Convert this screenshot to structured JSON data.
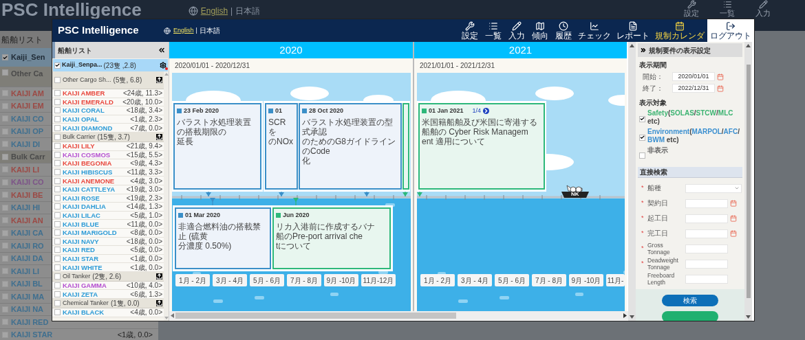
{
  "background": {
    "title": "PSC Intelligence",
    "language": {
      "english": "English",
      "separator": "|",
      "japanese": "日本語"
    },
    "nav": [
      "設定",
      "一覧",
      "入力"
    ],
    "sidebar_title": "船舶リスト",
    "fleet": {
      "name": "Kaiji_Sen",
      "checked": true
    },
    "rows": [
      {
        "kind": "category",
        "label": "Other Ca",
        "color": "#4a4a4a",
        "checked": false
      },
      {
        "kind": "ship",
        "label": "KAIJI AM",
        "color": "#9c4a45",
        "checked": false
      },
      {
        "kind": "ship",
        "label": "KAIJI EM",
        "color": "#9c4a45",
        "checked": false
      },
      {
        "kind": "ship",
        "label": "KAIJI CO",
        "color": "#3f6f8f",
        "checked": false
      },
      {
        "kind": "ship",
        "label": "KAIJI OP",
        "color": "#3f6f8f",
        "checked": false
      },
      {
        "kind": "ship",
        "label": "KAIJI DI",
        "color": "#3f6f8f",
        "checked": false
      },
      {
        "kind": "category",
        "label": "Bulk Carr",
        "color": "#4a4a4a",
        "checked": false
      },
      {
        "kind": "ship",
        "label": "KAIJI LI",
        "color": "#9c4a45",
        "checked": false
      },
      {
        "kind": "ship",
        "label": "KAIJI CO",
        "color": "#7d5488",
        "checked": false
      },
      {
        "kind": "ship",
        "label": "KAIJI BE",
        "color": "#9c4a45",
        "checked": false
      },
      {
        "kind": "ship",
        "label": "KAIJI HI",
        "color": "#3f6f8f",
        "checked": false
      },
      {
        "kind": "ship",
        "label": "KAIJI AN",
        "color": "#9c4a45",
        "checked": false
      },
      {
        "kind": "ship",
        "label": "KAIJI CA",
        "color": "#3f6f8f",
        "checked": false
      },
      {
        "kind": "ship",
        "label": "KAIJI RO",
        "color": "#3f6f8f",
        "checked": false
      },
      {
        "kind": "ship",
        "label": "KAIJI DA",
        "color": "#3f6f8f",
        "checked": false
      },
      {
        "kind": "ship",
        "label": "KAIJI LI",
        "color": "#3f6f8f",
        "checked": false
      },
      {
        "kind": "ship",
        "label": "KAIJI BL",
        "color": "#3f6f8f",
        "checked": false
      },
      {
        "kind": "ship",
        "label": "KAIJI MA",
        "color": "#3f6f8f",
        "checked": false
      },
      {
        "kind": "ship",
        "label": "KAIJI NA",
        "color": "#3f6f8f",
        "checked": false
      },
      {
        "kind": "ship",
        "label": "KAIJI RED",
        "color": "#3f6f8f",
        "checked": false
      },
      {
        "kind": "ship",
        "label": "KAIJI STAR",
        "info": "<1歳, 0.0>",
        "color": "#3f6f8f",
        "checked": false
      }
    ]
  },
  "app": {
    "title": "PSC Intelligence",
    "language": [
      {
        "label": "English",
        "selected": true
      },
      {
        "label": "日本語",
        "selected": false
      }
    ],
    "language_separator": "|",
    "nav": [
      {
        "label": "設定",
        "kind": "menu",
        "selected": false
      },
      {
        "label": "一覧",
        "kind": "menu",
        "selected": false
      },
      {
        "label": "入力",
        "kind": "menu",
        "selected": false
      },
      {
        "label": "傾向",
        "kind": "menu",
        "selected": false
      },
      {
        "label": "履歴",
        "kind": "menu",
        "selected": false
      },
      {
        "label": "チェック",
        "kind": "menu",
        "selected": false
      },
      {
        "label": "レポート",
        "kind": "menu",
        "selected": false
      },
      {
        "label": "規制カレンダ",
        "kind": "menu",
        "selected": true
      },
      {
        "label": "ログアウト",
        "kind": "logout",
        "selected": false
      }
    ]
  },
  "sidebar": {
    "title": "船舶リスト",
    "fleet": {
      "name": "Kaiji_Senpa...",
      "count": "(23隻 ,2.8)",
      "checked": true,
      "selected": true,
      "children": [
        {
          "name": "Other Cargo Sh...",
          "count": "(5隻, 6.8)",
          "checked": false,
          "children": [
            {
              "name": "KAIJI AMBER",
              "info": "<24歳, 11.3>",
              "color": "#e8463c",
              "checked": false
            },
            {
              "name": "KAIJI EMERALD",
              "info": "<20歳, 10.0>",
              "color": "#e8463c",
              "checked": false
            },
            {
              "name": "KAIJI CORAL",
              "info": "<18歳, 3.4>",
              "color": "#2a9ad6",
              "checked": false
            },
            {
              "name": "KAIJI OPAL",
              "info": "<1歳, 2.3>",
              "color": "#2a9ad6",
              "checked": false
            },
            {
              "name": "KAIJI DIAMOND",
              "info": "<7歳, 0.0>",
              "color": "#2a9ad6",
              "checked": false
            }
          ]
        },
        {
          "name": "Bulk Carrier",
          "count": "(15隻, 3.7)",
          "checked": false,
          "children": [
            {
              "name": "KAIJI LILY",
              "info": "<21歳, 9.4>",
              "color": "#e8463c",
              "checked": false
            },
            {
              "name": "KAIJI COSMOS",
              "info": "<15歳, 5.5>",
              "color": "#b44fd0",
              "checked": false
            },
            {
              "name": "KAIJI BEGONIA",
              "info": "<9歳, 4.3>",
              "color": "#e8463c",
              "checked": false
            },
            {
              "name": "KAIJI HIBISCUS",
              "info": "<11歳, 3.3>",
              "color": "#2a9ad6",
              "checked": false
            },
            {
              "name": "KAIJI ANEMONE",
              "info": "<4歳, 3.0>",
              "color": "#e8463c",
              "checked": false
            },
            {
              "name": "KAIJI CATTLEYA",
              "info": "<19歳, 3.0>",
              "color": "#2a9ad6",
              "checked": false
            },
            {
              "name": "KAIJI ROSE",
              "info": "<19歳, 2.3>",
              "color": "#2a9ad6",
              "checked": false
            },
            {
              "name": "KAIJI DAHLIA",
              "info": "<14歳, 1.3>",
              "color": "#2a9ad6",
              "checked": false
            },
            {
              "name": "KAIJI LILAC",
              "info": "<5歳, 1.0>",
              "color": "#2a9ad6",
              "checked": false
            },
            {
              "name": "KAIJI BLUE",
              "info": "<11歳, 0.0>",
              "color": "#2a9ad6",
              "checked": false
            },
            {
              "name": "KAIJI MARIGOLD",
              "info": "<8歳, 0.0>",
              "color": "#2a9ad6",
              "checked": false
            },
            {
              "name": "KAIJI NAVY",
              "info": "<18歳, 0.0>",
              "color": "#2a9ad6",
              "checked": false
            },
            {
              "name": "KAIJI RED",
              "info": "<5歳, 0.0>",
              "color": "#2a9ad6",
              "checked": false
            },
            {
              "name": "KAIJI STAR",
              "info": "<1歳, 0.0>",
              "color": "#2a9ad6",
              "checked": false
            },
            {
              "name": "KAIJI WHITE",
              "info": "<1歳, 0.0>",
              "color": "#2a9ad6",
              "checked": false
            }
          ]
        },
        {
          "name": "Oil Tanker",
          "count": "(2隻, 2.6)",
          "checked": false,
          "children": [
            {
              "name": "KAIJI GAMMA",
              "info": "<10歳, 4.0>",
              "color": "#b44fd0",
              "checked": false
            },
            {
              "name": "KAIJI ZETA",
              "info": "<6歳, 1.3>",
              "color": "#2a9ad6",
              "checked": false
            }
          ]
        },
        {
          "name": "Chemical Tanker",
          "count": "(1隻, 0.0)",
          "checked": false,
          "children": [
            {
              "name": "KAIJI BLACK",
              "info": "<4歳, 0.0>",
              "color": "#2a9ad6",
              "checked": false
            }
          ]
        }
      ]
    }
  },
  "timeline": {
    "years": [
      {
        "year": "2020",
        "range": "2020/01/01 - 2020/12/31",
        "cards": [
          {
            "kind": "environment",
            "date": "23 Feb 2020",
            "lines": [
              "バラスト水処理装置の搭載期限の",
              "延長"
            ]
          },
          {
            "kind": "environment",
            "date": "01",
            "lines": [
              "SCR を",
              "のNOx"
            ]
          },
          {
            "kind": "environment",
            "date": "28 Oct 2020",
            "lines": [
              "バラスト水処理装置の型式承認",
              "のためのG8ガイドラインのCode",
              "化"
            ]
          },
          {
            "kind": "safety"
          },
          {
            "kind": "environment",
            "date": "01 Mar 2020",
            "lines": [
              "非適合燃料油の搭載禁止 (硫黄",
              "分濃度 0.50%)"
            ]
          },
          {
            "kind": "safety",
            "date": "Jun 2020",
            "lines": [
              "リカ入港前に作成するバナ",
              "船のPre-port arrival che",
              "tについて"
            ]
          }
        ],
        "months": [
          "1月 - 2月",
          "3月 - 4月",
          "5月 - 6月",
          "7月 - 8月",
          "9月 -10月",
          "11月-12月"
        ]
      },
      {
        "year": "2021",
        "range": "2021/01/01 - 2021/12/31",
        "cards": [
          {
            "kind": "safety",
            "date": "01 Jan 2021",
            "page": "1/4",
            "lines": [
              "米国籍船舶及び米国に寄港する",
              "船舶の Cyber Risk Managem",
              "ent 適用について"
            ]
          }
        ],
        "ship_label": "NK",
        "months": [
          "1月 - 2月",
          "3月 - 4月",
          "5月 - 6月",
          "7月 - 8月",
          "9月 -10月",
          "11月-"
        ]
      }
    ]
  },
  "settings": {
    "title": "規制要件の表示設定",
    "period_label": "表示期間",
    "start": {
      "label": "開始：",
      "value": "2020/01/01"
    },
    "end": {
      "label": "終了：",
      "value": "2022/12/31"
    },
    "target_label": "表示対象",
    "targets": [
      {
        "checked": true,
        "parts": [
          {
            "text": "Safety",
            "color": "#3cb371"
          },
          {
            "text": "("
          },
          {
            "text": "SOLAS",
            "color": "#3cb371"
          },
          {
            "text": "/"
          },
          {
            "text": "STCW",
            "color": "#3cb371"
          },
          {
            "text": "/"
          },
          {
            "text": "MLC",
            "color": "#3cb371"
          },
          {
            "text": " etc)"
          }
        ]
      },
      {
        "checked": true,
        "parts": [
          {
            "text": "Environment",
            "color": "#3a8fd0"
          },
          {
            "text": "("
          },
          {
            "text": "MARPOL",
            "color": "#3a8fd0"
          },
          {
            "text": "/"
          },
          {
            "text": "AFC",
            "color": "#3a8fd0"
          },
          {
            "text": "/"
          },
          {
            "text": "BWM",
            "color": "#3a8fd0"
          },
          {
            "text": " etc)"
          }
        ]
      },
      {
        "checked": false,
        "parts": [
          {
            "text": "非表示",
            "color": "#666666"
          }
        ]
      }
    ],
    "search_title": "直接検索",
    "required_mark": "*",
    "fields": [
      {
        "label": "船種",
        "required": true,
        "kind": "select"
      },
      {
        "label": "契約日",
        "required": true,
        "kind": "date"
      },
      {
        "label": "起工日",
        "required": true,
        "kind": "date"
      },
      {
        "label": "完工日",
        "required": true,
        "kind": "date"
      },
      {
        "label": "Gross Tonnage",
        "required": true,
        "kind": "text"
      },
      {
        "label": "Deadweight Tonnage",
        "required": true,
        "kind": "text"
      },
      {
        "label": "Freeboard Length",
        "required": false,
        "kind": "text"
      }
    ],
    "search_button": "検索"
  }
}
